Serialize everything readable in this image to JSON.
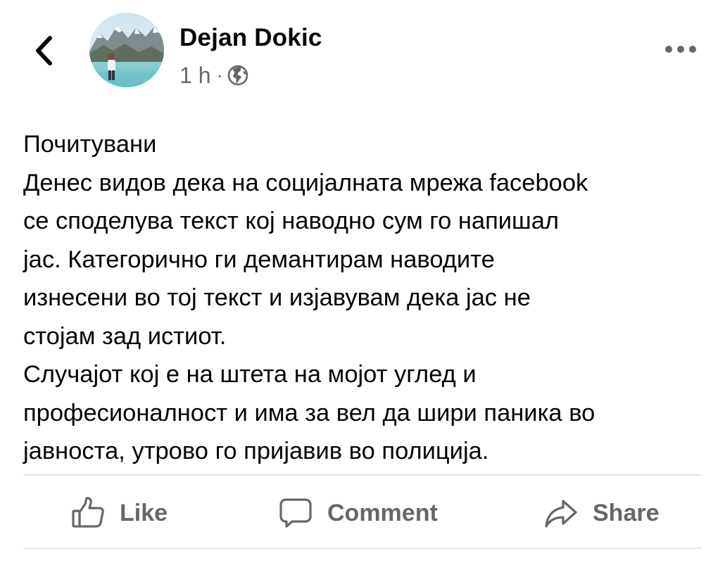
{
  "header": {
    "back_icon": "chevron-left-icon",
    "author_name": "Dejan Dokic",
    "time": "1 h",
    "separator": "·",
    "privacy_icon": "globe-icon",
    "more_icon": "more-horizontal-icon"
  },
  "post": {
    "lines": [
      "Почитувани",
      "Денес видов дека на социјалната мрежа facebook",
      "се споделува текст кој наводно сум го напишал",
      "јас. Категорично ги демантирам наводите",
      "изнесени во тој текст и изјавувам дека јас не",
      "стојам зад истиот.",
      "Случајот кој е на штета на мојот углед и",
      "професионалност и има за вел да шири паника во",
      "јавноста, утрово го пријавив во полиција."
    ]
  },
  "actions": {
    "like": {
      "label": "Like",
      "icon": "thumbs-up-icon"
    },
    "comment": {
      "label": "Comment",
      "icon": "comment-bubble-icon"
    },
    "share": {
      "label": "Share",
      "icon": "share-arrow-icon"
    }
  },
  "colors": {
    "text": "#050505",
    "secondary": "#65676b",
    "divider": "#e4e6eb"
  }
}
